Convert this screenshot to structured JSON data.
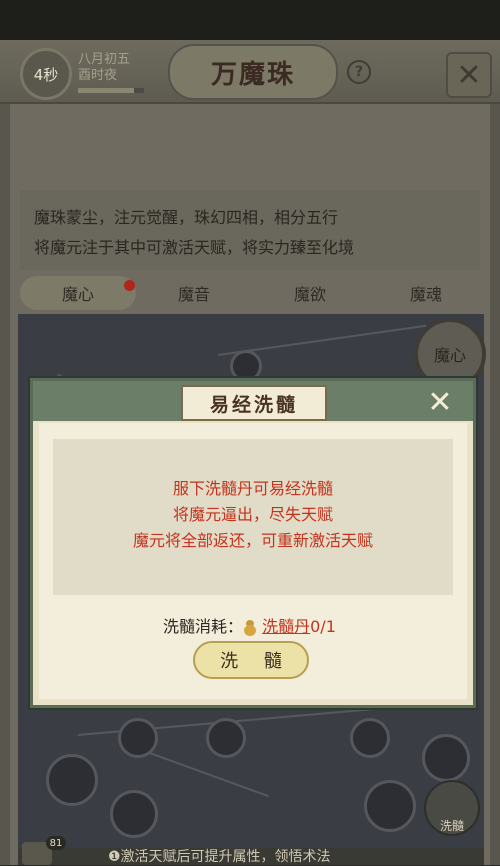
{
  "header": {
    "timer": "4秒",
    "date_line1": "八月初五",
    "date_line2": "酉时夜",
    "progress_fraction": 0.85,
    "title": "万魔珠",
    "help_label": "?"
  },
  "description": {
    "line1": "魔珠蒙尘，注元觉醒，珠幻四相，相分五行",
    "line2": "将魔元注于其中可激活天赋，将实力臻至化境"
  },
  "tabs": [
    {
      "label": "魔心",
      "active": true,
      "has_notification": true
    },
    {
      "label": "魔音",
      "active": false
    },
    {
      "label": "魔欲",
      "active": false
    },
    {
      "label": "魔魂",
      "active": false
    }
  ],
  "board": {
    "center_badge": "魔心",
    "wash_corner_label": "洗髓"
  },
  "modal": {
    "title": "易经洗髓",
    "message_lines": [
      "服下洗髓丹可易经洗髓",
      "将魔元逼出，尽失天赋",
      "魔元将全部返还，可重新激活天赋"
    ],
    "cost_label": "洗髓消耗：",
    "cost_item": "洗髓丹",
    "cost_count": "0/1",
    "confirm_button": "洗 髓"
  },
  "bottom": {
    "chat_count": "81",
    "tip_text": "❶激活天赋后可提升属性，领悟术法"
  },
  "colors": {
    "accent_red": "#c4331e",
    "modal_header_green": "#6a7e68",
    "button_gold": "#ece2a8"
  }
}
